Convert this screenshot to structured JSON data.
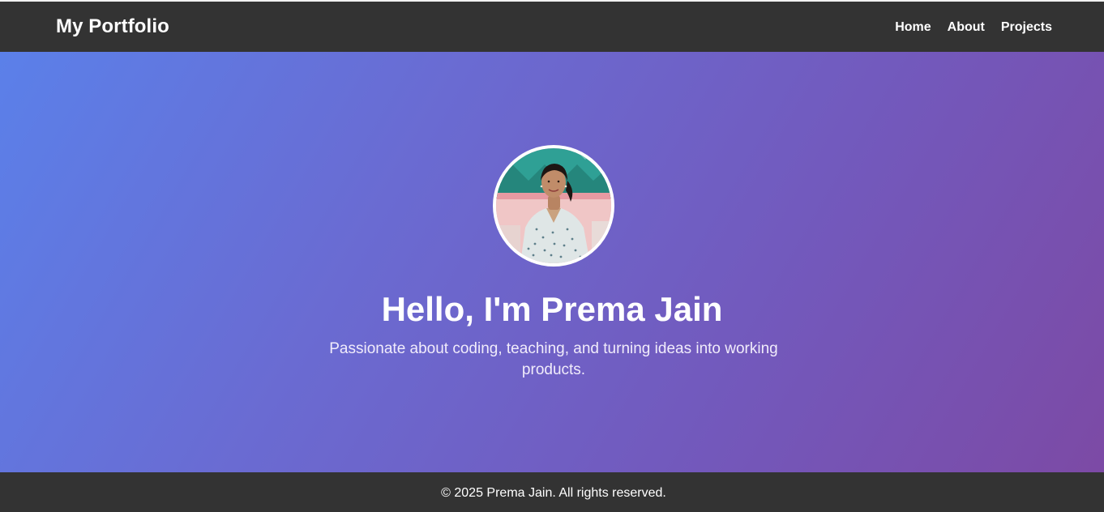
{
  "navbar": {
    "brand": "My Portfolio",
    "links": [
      {
        "label": "Home"
      },
      {
        "label": "About"
      },
      {
        "label": "Projects"
      }
    ]
  },
  "hero": {
    "title": "Hello, I'm Prema Jain",
    "subtitle": "Passionate about coding, teaching, and turning ideas into working products."
  },
  "footer": {
    "text": "© 2025 Prema Jain. All rights reserved."
  },
  "colors": {
    "nav_bg": "#333333",
    "gradient_start": "#5b80e9",
    "gradient_end": "#7c4aa5",
    "text": "#ffffff"
  }
}
